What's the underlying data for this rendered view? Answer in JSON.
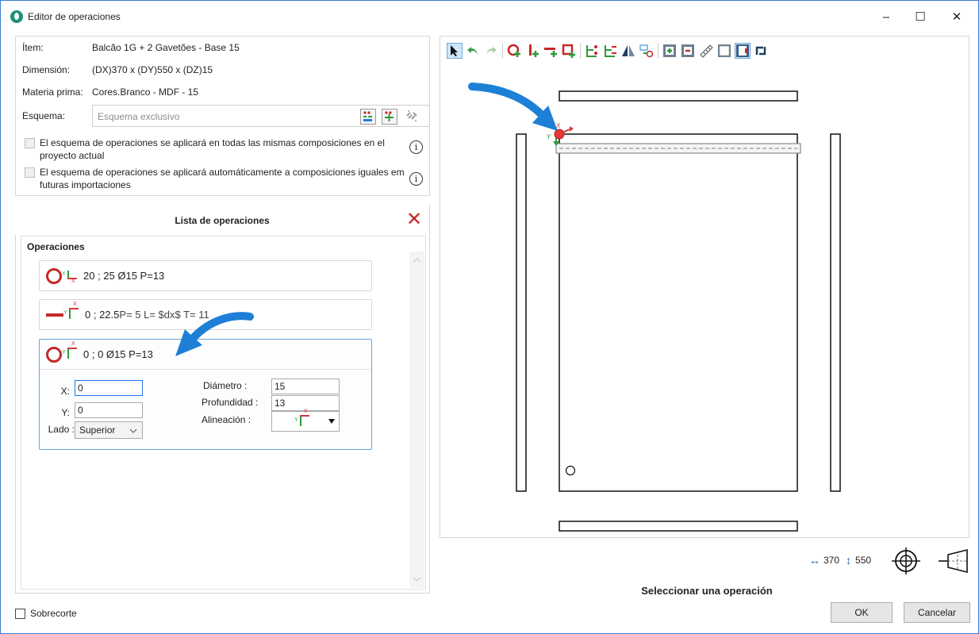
{
  "window": {
    "title": "Editor de operaciones",
    "controls": {
      "minimize": "–",
      "maximize": "☐",
      "close": "✕"
    }
  },
  "item_info": {
    "item_label": "Ítem:",
    "item_value": "Balcão 1G + 2 Gavetões - Base 15",
    "dimension_label": "Dimensión:",
    "dimension_value": "(DX)370 x (DY)550 x (DZ)15",
    "material_label": "Materia prima:",
    "material_value": "Cores.Branco - MDF - 15",
    "scheme_label": "Esquema:",
    "scheme_placeholder": "Esquema exclusivo"
  },
  "checkboxes": {
    "apply_project": "El esquema de operaciones se aplicará en todas las mismas composiciones en el proyecto actual",
    "apply_future": "El esquema de operaciones se aplicará automáticamente a composiciones iguales em futuras importaciones",
    "info_glyph": "i"
  },
  "operations_list": {
    "header": "Lista de operaciones",
    "close_glyph": "✕",
    "group_label": "Operaciones",
    "items": [
      {
        "icon": "drill-hole-icon",
        "text": "20 ; 25 Ø15 P=13"
      },
      {
        "icon": "groove-line-icon",
        "text_main": "0 ; 22.5",
        "text_rest": " P= 5 L= $dx$ T= 11"
      },
      {
        "icon": "drill-hole-icon",
        "text": "0 ; 0 Ø15 P=13"
      }
    ],
    "editor": {
      "x_label": "X:",
      "x_value": "0",
      "y_label": "Y:",
      "y_value": "0",
      "side_label": "Lado :",
      "side_value": "Superior",
      "diameter_label": "Diámetro :",
      "diameter_value": "15",
      "depth_label": "Profundidad :",
      "depth_value": "13",
      "alignment_label": "Alineación :"
    }
  },
  "preview": {
    "width_value": "370",
    "height_value": "550",
    "status": "Seleccionar una operación"
  },
  "footer": {
    "overcut_label": "Sobrecorte",
    "ok_label": "OK",
    "cancel_label": "Cancelar"
  },
  "colors": {
    "accent_red": "#c62828",
    "axis_green": "#2e9b3a",
    "axis_red": "#d23b3b",
    "selection_blue": "#63a4e6",
    "arrow_blue": "#1e7fd6"
  }
}
